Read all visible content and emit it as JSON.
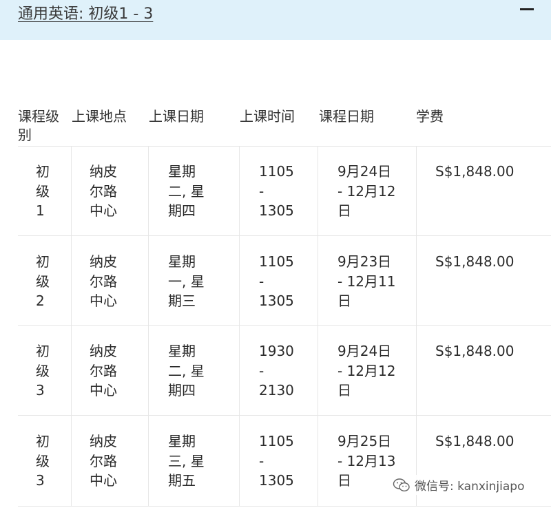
{
  "panel": {
    "title": "通用英语: 初级1 - 3",
    "collapse_icon": "minus-icon"
  },
  "table": {
    "headers": [
      "课程级\n别",
      "上课地点",
      "上课日期",
      "上课时间",
      "课程日期",
      "学费"
    ],
    "rows": [
      [
        "初\n级\n1",
        "纳皮\n尔路\n中心",
        "星期\n二, 星\n期四",
        "1105\n-\n1305",
        "9月24日\n- 12月12\n日",
        "S$1,848.00"
      ],
      [
        "初\n级\n2",
        "纳皮\n尔路\n中心",
        "星期\n一, 星\n期三",
        "1105\n-\n1305",
        "9月23日\n- 12月11\n日",
        "S$1,848.00"
      ],
      [
        "初\n级\n3",
        "纳皮\n尔路\n中心",
        "星期\n二, 星\n期四",
        "1930\n-\n2130",
        "9月24日\n- 12月12\n日",
        "S$1,848.00"
      ],
      [
        "初\n级\n3",
        "纳皮\n尔路\n中心",
        "星期\n三, 星\n期五",
        "1105\n-\n1305",
        "9月25日\n- 12月13\n日",
        "S$1,848.00"
      ]
    ]
  },
  "watermark": {
    "icon": "wechat-icon",
    "text": "微信号: kanxinjiapo"
  },
  "colors": {
    "header_bg": "#dff1fa",
    "grid_line": "#e6e6e6"
  }
}
